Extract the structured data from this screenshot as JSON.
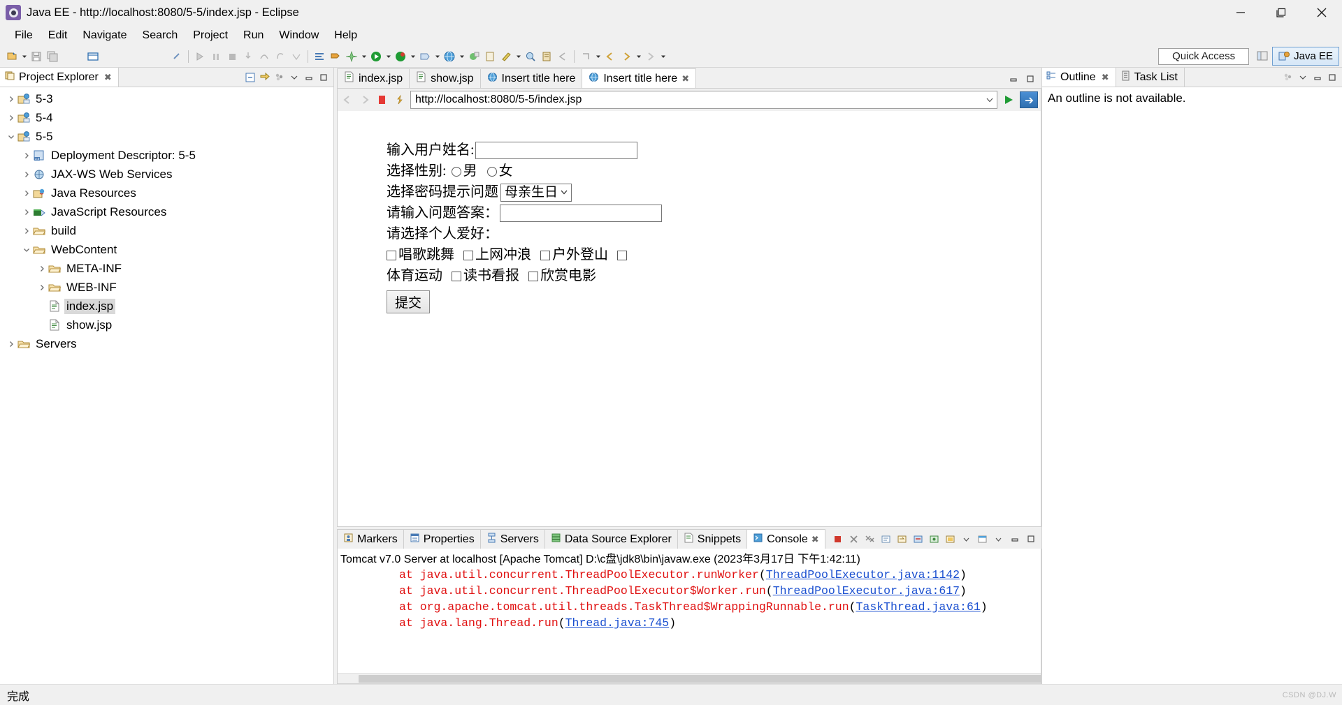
{
  "window": {
    "title": "Java EE - http://localhost:8080/5-5/index.jsp - Eclipse",
    "app_icon": "eclipse-icon",
    "minimize": "—",
    "maximize": "❐",
    "close": "✕"
  },
  "menu": {
    "items": [
      {
        "label": "File"
      },
      {
        "label": "Edit"
      },
      {
        "label": "Navigate"
      },
      {
        "label": "Search"
      },
      {
        "label": "Project"
      },
      {
        "label": "Run"
      },
      {
        "label": "Window"
      },
      {
        "label": "Help"
      }
    ]
  },
  "toolbar": {
    "quick_access": "Quick Access",
    "perspective_label": "Java EE",
    "icons": [
      "new-wizard-icon",
      "save-icon",
      "save-all-icon",
      "print-icon",
      "toggle-breadcrumb-icon",
      "link-icon",
      "run-last-tool-icon",
      "pause-icon",
      "stop-icon",
      "step-into-icon",
      "step-over-icon",
      "step-return-icon",
      "drop-to-frame-icon",
      "next-annotation-icon",
      "skip-breakpoints-icon",
      "new-java-project-icon",
      "run-icon",
      "debug-icon",
      "run-external-tools-icon",
      "web-browser-icon",
      "new-server-icon",
      "open-type-icon",
      "search-icon",
      "open-task-icon",
      "previous-edit-icon",
      "back-icon",
      "forward-icon"
    ]
  },
  "project_explorer": {
    "tab_label": "Project Explorer",
    "tab_icon": "project-explorer-icon",
    "tools": [
      "collapse-all-icon",
      "link-with-editor-icon",
      "view-menu-icon",
      "minimize-icon",
      "maximize-icon"
    ],
    "tree": [
      {
        "label": "5-3",
        "icon": "project-icon",
        "depth": 0,
        "arrow": "collapsed",
        "selected": false
      },
      {
        "label": "5-4",
        "icon": "project-icon",
        "depth": 0,
        "arrow": "collapsed",
        "selected": false
      },
      {
        "label": "5-5",
        "icon": "project-icon",
        "depth": 0,
        "arrow": "expanded",
        "selected": false
      },
      {
        "label": "Deployment Descriptor: 5-5",
        "icon": "deployment-descriptor-icon",
        "depth": 1,
        "arrow": "collapsed",
        "selected": false
      },
      {
        "label": "JAX-WS Web Services",
        "icon": "jaxws-icon",
        "depth": 1,
        "arrow": "collapsed",
        "selected": false
      },
      {
        "label": "Java Resources",
        "icon": "java-resources-icon",
        "depth": 1,
        "arrow": "collapsed",
        "selected": false
      },
      {
        "label": "JavaScript Resources",
        "icon": "javascript-resources-icon",
        "depth": 1,
        "arrow": "collapsed",
        "selected": false
      },
      {
        "label": "build",
        "icon": "folder-icon",
        "depth": 1,
        "arrow": "collapsed",
        "selected": false
      },
      {
        "label": "WebContent",
        "icon": "folder-icon",
        "depth": 1,
        "arrow": "expanded",
        "selected": false
      },
      {
        "label": "META-INF",
        "icon": "folder-icon",
        "depth": 2,
        "arrow": "collapsed",
        "selected": false
      },
      {
        "label": "WEB-INF",
        "icon": "folder-icon",
        "depth": 2,
        "arrow": "collapsed",
        "selected": false
      },
      {
        "label": "index.jsp",
        "icon": "jsp-file-icon",
        "depth": 2,
        "arrow": "none",
        "selected": true
      },
      {
        "label": "show.jsp",
        "icon": "jsp-file-icon",
        "depth": 2,
        "arrow": "none",
        "selected": false
      },
      {
        "label": "Servers",
        "icon": "folder-icon",
        "depth": 0,
        "arrow": "collapsed",
        "selected": false
      }
    ]
  },
  "editor": {
    "tabs": [
      {
        "label": "index.jsp",
        "icon": "jsp-file-icon",
        "active": false,
        "closable": false
      },
      {
        "label": "show.jsp",
        "icon": "jsp-file-icon",
        "active": false,
        "closable": false
      },
      {
        "label": "Insert title here",
        "icon": "web-browser-icon",
        "active": false,
        "closable": false
      },
      {
        "label": "Insert title here",
        "icon": "web-browser-icon",
        "active": true,
        "closable": true
      }
    ],
    "tools": [
      "minimize-icon",
      "maximize-icon"
    ]
  },
  "browser": {
    "url": "http://localhost:8080/5-5/index.jsp",
    "back_icon": "back-arrow-icon",
    "forward_icon": "forward-arrow-icon",
    "stop_icon": "stop-icon",
    "refresh_icon": "refresh-icon",
    "go_icon": "go-play-icon",
    "open-external_icon": "open-external-browser-icon"
  },
  "web_form": {
    "rows": {
      "username_label": "输入用户姓名:",
      "username_value": "",
      "gender_label": "选择性别:",
      "gender_options": [
        "男",
        "女"
      ],
      "question_label": "选择密码提示问题",
      "question_selected": "母亲生日",
      "answer_label": "请输入问题答案：",
      "answer_value": "",
      "hobby_label": "请选择个人爱好：",
      "hobbies_line1": [
        "唱歌跳舞",
        "上网冲浪",
        "户外登山"
      ],
      "hobbies_line2_first_text": "体育运动",
      "hobbies_line2": [
        "读书看报",
        "欣赏电影"
      ],
      "submit_label": "提交"
    }
  },
  "outline": {
    "tabs": [
      {
        "label": "Outline",
        "icon": "outline-icon",
        "active": true,
        "closable": true
      },
      {
        "label": "Task List",
        "icon": "task-list-icon",
        "active": false,
        "closable": false
      }
    ],
    "message": "An outline is not available.",
    "tools": [
      "focus-icon",
      "view-menu-icon",
      "minimize-icon",
      "maximize-icon"
    ]
  },
  "console": {
    "tabs": [
      {
        "label": "Markers",
        "icon": "markers-icon",
        "active": false,
        "closable": false
      },
      {
        "label": "Properties",
        "icon": "properties-icon",
        "active": false,
        "closable": false
      },
      {
        "label": "Servers",
        "icon": "servers-icon",
        "active": false,
        "closable": false
      },
      {
        "label": "Data Source Explorer",
        "icon": "data-source-explorer-icon",
        "active": false,
        "closable": false
      },
      {
        "label": "Snippets",
        "icon": "snippets-icon",
        "active": false,
        "closable": false
      },
      {
        "label": "Console",
        "icon": "console-icon",
        "active": true,
        "closable": true
      }
    ],
    "tools": [
      "terminate-icon",
      "remove-launch-icon",
      "remove-all-terminated-icon",
      "scroll-lock-icon",
      "word-wrap-icon",
      "clear-console-icon",
      "pin-console-icon",
      "display-selected-console-icon",
      "open-console-icon",
      "view-menu-icon",
      "minimize-icon",
      "maximize-icon"
    ],
    "header": "Tomcat v7.0 Server at localhost [Apache Tomcat] D:\\c盘\\jdk8\\bin\\javaw.exe (2023年3月17日 下午1:42:11)",
    "lines": [
      {
        "indent": 1,
        "text": "at java.util.concurrent.ThreadPoolExecutor.runWorker",
        "open": "(",
        "link": "ThreadPoolExecutor.java:1142",
        "close": ")"
      },
      {
        "indent": 1,
        "text": "at java.util.concurrent.ThreadPoolExecutor$Worker.run",
        "open": "(",
        "link": "ThreadPoolExecutor.java:617",
        "close": ")"
      },
      {
        "indent": 1,
        "text": "at org.apache.tomcat.util.threads.TaskThread$WrappingRunnable.run",
        "open": "(",
        "link": "TaskThread.java:61",
        "close": ")"
      },
      {
        "indent": 1,
        "text": "at java.lang.Thread.run",
        "open": "(",
        "link": "Thread.java:745",
        "close": ")"
      }
    ]
  },
  "statusbar": {
    "message": "完成",
    "watermark": "CSDN @DJ.W"
  },
  "colors": {
    "accent": "#2f6fb0",
    "error_text": "#e01010",
    "link": "#1a4fd0",
    "chrome": "#f0f0f0",
    "selection": "#d9d9d9"
  }
}
